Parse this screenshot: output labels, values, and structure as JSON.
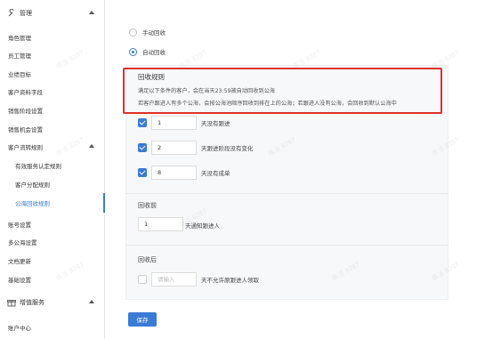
{
  "sidebar": {
    "items": [
      {
        "label": "管理",
        "type": "group",
        "icon": "wrench-icon",
        "expanded": true
      },
      {
        "label": "角色管理"
      },
      {
        "label": "员工管理"
      },
      {
        "label": "业绩目标"
      },
      {
        "label": "客户资料字段"
      },
      {
        "label": "销售阶段设置"
      },
      {
        "label": "销售机会设置"
      },
      {
        "label": "客户流转规则",
        "expanded": true
      },
      {
        "label": "有效服务认定规则",
        "sub": true
      },
      {
        "label": "客户分配规则",
        "sub": true
      },
      {
        "label": "公海回收规则",
        "sub": true,
        "active": true
      },
      {
        "label": "账号设置"
      },
      {
        "label": "多公海设置"
      },
      {
        "label": "文档更新"
      },
      {
        "label": "基础设置"
      },
      {
        "label": "增值服务",
        "type": "group",
        "icon": "gift-icon",
        "expanded": true
      },
      {
        "label": "账户中心"
      }
    ]
  },
  "recycle_mode": {
    "manual_label": "手动回收",
    "auto_label": "自动回收",
    "selected": "auto"
  },
  "rules": {
    "title": "回收规则",
    "line1": "满足以下条件的客户，会在当天23:59被自动回收到公海",
    "line2": "若客户跟进人有多个公海，会按公海池顺序回收到排在上的公海；若跟进人没有公海，会回收到默认公海中"
  },
  "conditions": [
    {
      "checked": true,
      "value": "1",
      "label": "天没有跟进"
    },
    {
      "checked": true,
      "value": "2",
      "label": "天跟进阶段没有变化"
    },
    {
      "checked": true,
      "value": "8",
      "label": "天没有成单"
    }
  ],
  "before": {
    "title": "回收前",
    "value": "1",
    "label": "天通知跟进人"
  },
  "after": {
    "title": "回收后",
    "placeholder": "请输入",
    "label": "天不允许原跟进人领取"
  },
  "save_label": "保存",
  "watermark": "陈洁 8287",
  "colors": {
    "accent": "#3a7bd5",
    "highlight": "#e0312d"
  }
}
